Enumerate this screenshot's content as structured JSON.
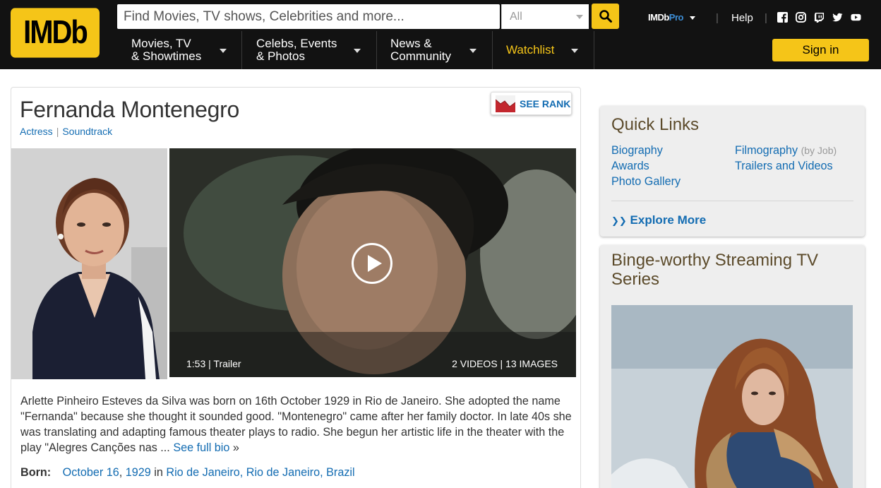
{
  "header": {
    "logo": "IMDb",
    "search_placeholder": "Find Movies, TV shows, Celebrities and more...",
    "search_category": "All",
    "nav": [
      {
        "line1": "Movies, TV",
        "line2": "& Showtimes"
      },
      {
        "line1": "Celebs, Events",
        "line2": "& Photos"
      },
      {
        "line1": "News &",
        "line2": "Community"
      }
    ],
    "watchlist": "Watchlist",
    "pro_prefix": "IMDb",
    "pro_suffix": "Pro",
    "help": "Help",
    "sign_in": "Sign in",
    "social_icons": [
      "facebook-icon",
      "instagram-icon",
      "twitch-icon",
      "twitter-icon",
      "youtube-icon"
    ]
  },
  "person": {
    "name": "Fernanda Montenegro",
    "roles": [
      "Actress",
      "Soundtrack"
    ],
    "see_rank": "SEE RANK",
    "video_duration": "1:53",
    "video_type": "Trailer",
    "media_counts": "2 VIDEOS | 13 IMAGES",
    "bio": "Arlette Pinheiro Esteves da Silva was born on 16th October 1929 in Rio de Janeiro. She adopted the name \"Fernanda\" because she thought it sounded good. \"Montenegro\" came after her family doctor. In late 40s she was translating and adapting famous theater plays to radio. She begun her artistic life in the theater with the play \"Alegres Canções nas ...",
    "see_full_bio": "See full bio",
    "born_label": "Born:",
    "born_date": "October 16",
    "born_year": "1929",
    "born_in": "in",
    "born_place": "Rio de Janeiro, Rio de Janeiro, Brazil"
  },
  "quick_links": {
    "title": "Quick Links",
    "biography": "Biography",
    "awards": "Awards",
    "photo_gallery": "Photo Gallery",
    "filmography": "Filmography",
    "by_job": "(by Job)",
    "trailers": "Trailers and Videos",
    "explore_more": "Explore More"
  },
  "binge": {
    "title": "Binge-worthy Streaming TV Series"
  },
  "colors": {
    "brand": "#f5c518",
    "link": "#136cb2",
    "header_bg": "#121212"
  }
}
